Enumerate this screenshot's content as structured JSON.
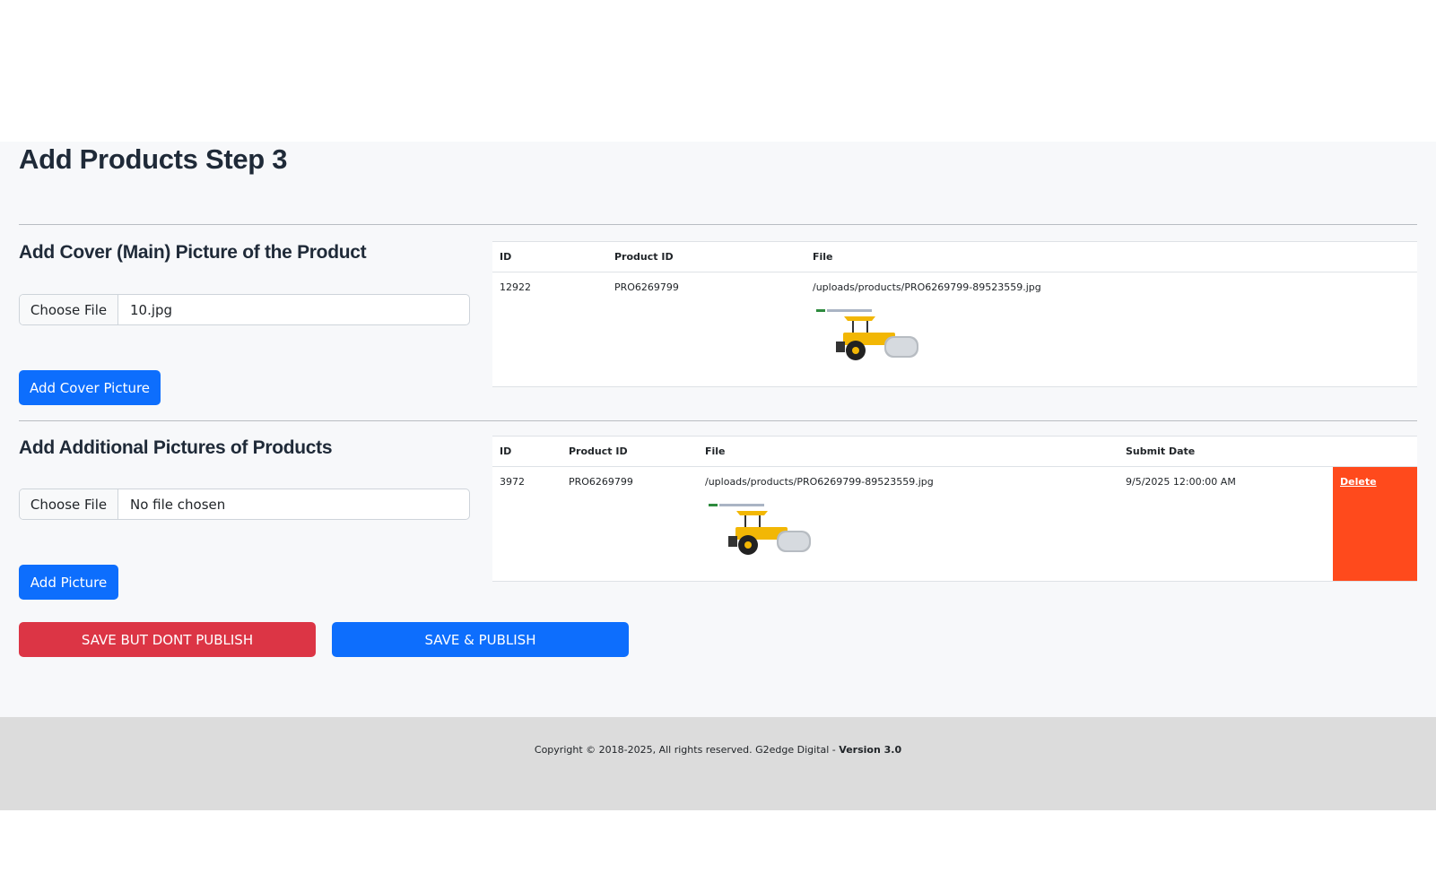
{
  "page": {
    "title": "Add Products Step 3"
  },
  "cover_section": {
    "title": "Add Cover (Main) Picture of the Product",
    "file_button_label": "Choose File",
    "file_name": "10.jpg",
    "submit_label": "Add Cover Picture",
    "table": {
      "headers": [
        "ID",
        "Product ID",
        "File"
      ],
      "rows": [
        {
          "id": "12922",
          "product_id": "PRO6269799",
          "file": "/uploads/products/PRO6269799-89523559.jpg"
        }
      ]
    }
  },
  "additional_section": {
    "title": "Add Additional Pictures of Products",
    "file_button_label": "Choose File",
    "file_name": "No file chosen",
    "submit_label": "Add Picture",
    "table": {
      "headers": [
        "ID",
        "Product ID",
        "File",
        "Submit Date",
        ""
      ],
      "rows": [
        {
          "id": "3972",
          "product_id": "PRO6269799",
          "file": "/uploads/products/PRO6269799-89523559.jpg",
          "submit_date": "9/5/2025 12:00:00 AM",
          "action": "Delete"
        }
      ]
    }
  },
  "actions": {
    "save_draft_label": "SAVE BUT DONT PUBLISH",
    "save_publish_label": "SAVE & PUBLISH"
  },
  "footer": {
    "copyright": "Copyright © 2018-2025, All rights reserved. G2edge Digital - ",
    "version": "Version 3.0"
  },
  "colors": {
    "primary": "#0d6efd",
    "danger": "#dc3545",
    "delete_bg": "#ff4a1c",
    "content_bg": "#f7f8fa",
    "footer_bg": "#dcdcdc"
  }
}
